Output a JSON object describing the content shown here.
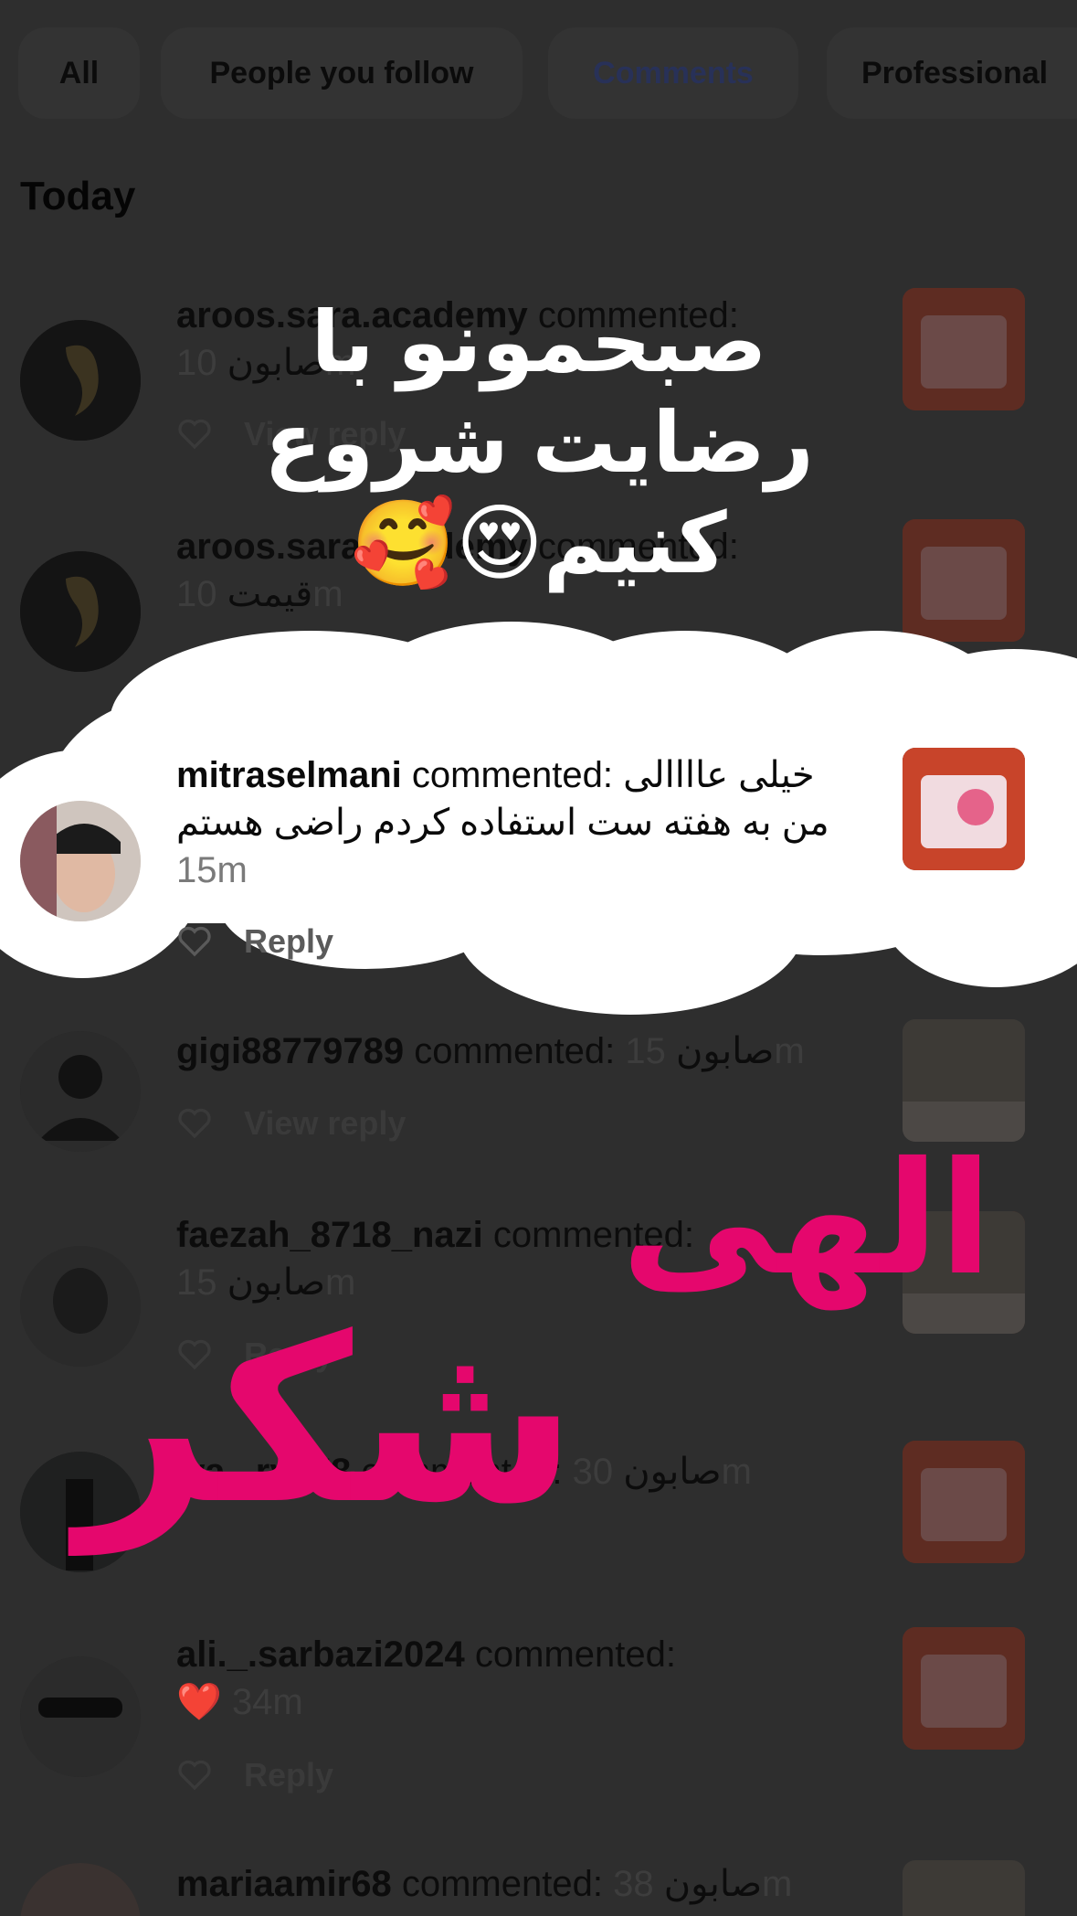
{
  "tabs": [
    {
      "label": "All"
    },
    {
      "label": "People you follow"
    },
    {
      "label": "Comments",
      "active": true
    },
    {
      "label": "Professional"
    }
  ],
  "section_title": "Today",
  "reply_label": "Reply",
  "view_reply_label": "View reply",
  "notifications": [
    {
      "user": "aroos.sara.academy",
      "action": "commented:",
      "comment": "صابون",
      "time": "10m",
      "action_label": "View reply"
    },
    {
      "user": "aroos.sara.academy",
      "action": "commented:",
      "comment": "قیمت",
      "time": "10m",
      "action_label": "Reply"
    },
    {
      "user": "mitraselmani",
      "action": "commented:",
      "comment": "خیلی عاااالی من به هفته ست استفاده کردم راضی هستم",
      "time": "15m",
      "action_label": "Reply"
    },
    {
      "user": "gigi88779789",
      "action": "commented:",
      "comment": "صابون",
      "time": "15m",
      "action_label": "View reply"
    },
    {
      "user": "faezah_8718_nazi",
      "action": "commented:",
      "comment": "صابون",
      "time": "15m",
      "action_label": "Reply"
    },
    {
      "user": "wa...ry778",
      "action": "commented:",
      "comment": "صابون",
      "time": "30m",
      "action_label": ""
    },
    {
      "user": "ali._.sarbazi2024",
      "action": "commented:",
      "comment": "❤️",
      "time": "34m",
      "action_label": "Reply"
    },
    {
      "user": "mariaamir68",
      "action": "commented:",
      "comment": "صابون",
      "time": "38m",
      "action_label": ""
    }
  ],
  "stickers": {
    "top_text": "صبحمونو با رضایت شروع کنیم😍🥰",
    "pink_text_1": "الهی",
    "pink_text_2": "شکر"
  },
  "colors": {
    "background": "#2e2e2e",
    "sticker_pink": "#e5076d",
    "cloud": "#ffffff"
  }
}
